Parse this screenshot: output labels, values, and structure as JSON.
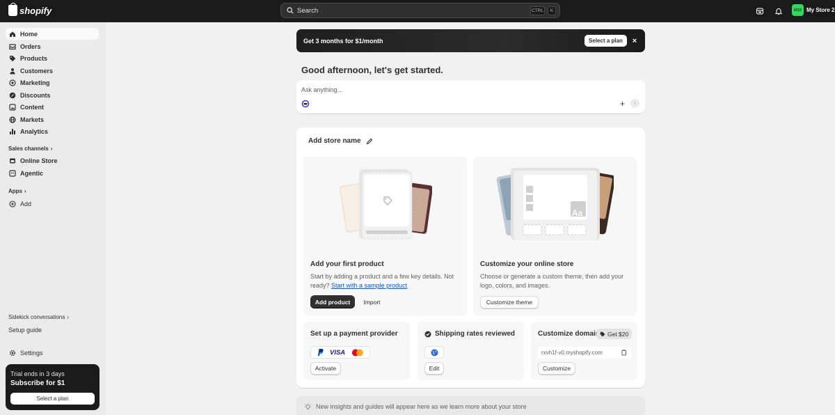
{
  "topbar": {
    "brand": "shopify",
    "search_placeholder": "Search",
    "shortcut_keys": [
      "CTRL",
      "K"
    ],
    "store_initials": "MS2",
    "store_name": "My Store 2"
  },
  "sidebar": {
    "items": [
      {
        "label": "Home",
        "icon": "home-icon",
        "active": true
      },
      {
        "label": "Orders",
        "icon": "orders-icon"
      },
      {
        "label": "Products",
        "icon": "tag-icon"
      },
      {
        "label": "Customers",
        "icon": "person-icon"
      },
      {
        "label": "Marketing",
        "icon": "target-icon"
      },
      {
        "label": "Discounts",
        "icon": "discount-icon"
      },
      {
        "label": "Content",
        "icon": "content-icon"
      },
      {
        "label": "Markets",
        "icon": "globe-icon"
      },
      {
        "label": "Analytics",
        "icon": "bar-chart-icon"
      }
    ],
    "sales_channels_label": "Sales channels",
    "channels": [
      {
        "label": "Online Store",
        "icon": "store-icon"
      },
      {
        "label": "Agentic",
        "icon": "agentic-icon"
      }
    ],
    "apps_label": "Apps",
    "add_label": "Add",
    "sidekick_label": "Sidekick conversations",
    "setup_guide_label": "Setup guide",
    "settings_label": "Settings",
    "trial": {
      "line1": "Trial ends in 3 days",
      "line2": "Subscribe for $1",
      "button": "Select a plan"
    }
  },
  "banner": {
    "text": "Get 3 months for $1/month",
    "button": "Select a plan",
    "close": "×"
  },
  "greeting": "Good afternoon, let's get started.",
  "ask": {
    "placeholder": "Ask anything...",
    "add": "+",
    "send": "↑"
  },
  "setup_card": {
    "store_name_label": "Add store name",
    "product_panel": {
      "title": "Add your first product",
      "desc": "Start by adding a product and a few key details. Not ready?",
      "link": "Start with a sample product",
      "primary_button": "Add product",
      "secondary_button": "Import"
    },
    "theme_panel": {
      "title": "Customize your online store",
      "desc": "Choose or generate a custom theme, then add your logo, colors, and images.",
      "button": "Customize theme",
      "preview_text": "Aa"
    },
    "payment": {
      "title": "Set up a payment provider",
      "visa": "VISA",
      "button": "Activate"
    },
    "shipping": {
      "title": "Shipping rates reviewed",
      "button": "Edit"
    },
    "domain": {
      "title": "Customize domain",
      "badge": "Get $20",
      "value": "rxvh1f-v0.myshopify.com",
      "button": "Customize"
    }
  },
  "insights": "New insights and guides will appear here as we learn more about your store",
  "colors": {
    "topbar": "#1a1a1a",
    "sidebar": "#ebebeb",
    "page": "#f1f1f1",
    "link": "#005bd3",
    "avatar": "#36d35f"
  }
}
